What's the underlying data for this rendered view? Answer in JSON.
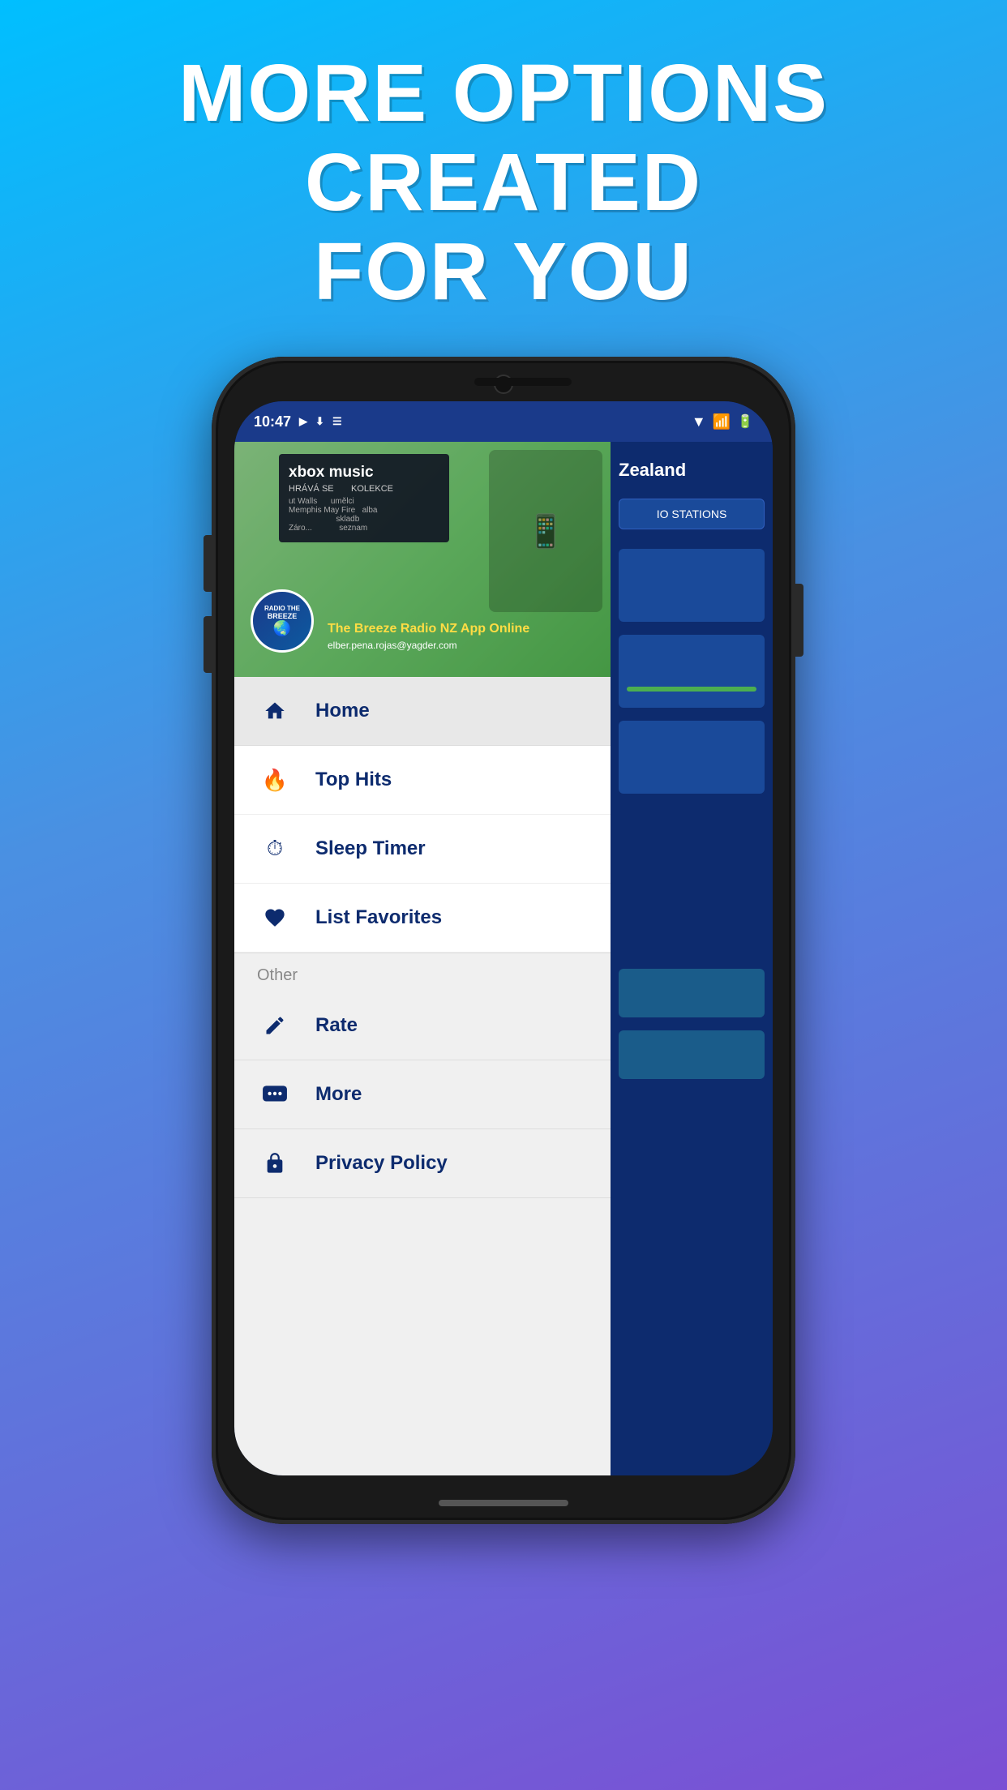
{
  "headline": {
    "line1": "MORE OPTIONS CREATED",
    "line2": "FOR YOU"
  },
  "status_bar": {
    "time": "10:47",
    "icons": [
      "play",
      "download",
      "menu"
    ],
    "right_icons": [
      "wifi",
      "signal",
      "battery"
    ]
  },
  "banner": {
    "title": "The Breeze Radio NZ App Online",
    "email": "elber.pena.rojas@yagder.com",
    "radio_logo_line1": "RADIO THE",
    "radio_logo_line2": "BREEZE"
  },
  "right_panel": {
    "header": "Zealand",
    "button": "IO STATIONS"
  },
  "menu_items": [
    {
      "id": "home",
      "label": "Home",
      "icon": "home",
      "active": true
    },
    {
      "id": "top-hits",
      "label": "Top Hits",
      "icon": "fire",
      "active": false
    },
    {
      "id": "sleep-timer",
      "label": "Sleep Timer",
      "icon": "timer",
      "active": false
    },
    {
      "id": "list-favorites",
      "label": "List Favorites",
      "icon": "heart",
      "active": false
    }
  ],
  "other_section": {
    "label": "Other"
  },
  "other_items": [
    {
      "id": "rate",
      "label": "Rate",
      "icon": "pencil"
    },
    {
      "id": "more",
      "label": "More",
      "icon": "chat"
    },
    {
      "id": "privacy-policy",
      "label": "Privacy Policy",
      "icon": "lock"
    }
  ]
}
